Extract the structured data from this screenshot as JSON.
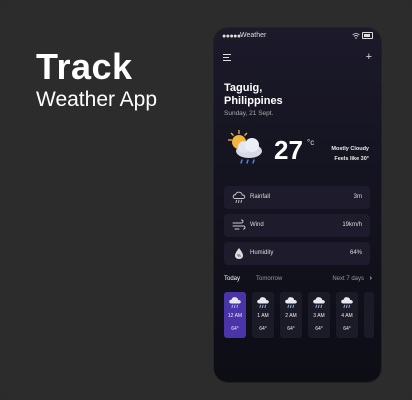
{
  "hero": {
    "title": "Track",
    "subtitle": "Weather App"
  },
  "status_bar": {
    "carrier": "Weather",
    "signal_dots": "●●●●●",
    "wifi": "wifi-icon",
    "battery": "battery-icon"
  },
  "header": {
    "menu_icon": "menu-icon",
    "add_icon": "plus-icon"
  },
  "location": {
    "city_line1": "Taguig,",
    "city_line2": "Philippines",
    "date": "Sunday, 21 Sept."
  },
  "current": {
    "temperature": "27",
    "unit": "°c",
    "condition": "Mostly Cloudy",
    "feels_like": "Feels like 30°",
    "icon": "partly-cloudy-rain-icon"
  },
  "metrics": [
    {
      "label": "Rainfall",
      "value": "3m",
      "icon": "rain-cloud-icon"
    },
    {
      "label": "Wind",
      "value": "19km/h",
      "icon": "wind-icon"
    },
    {
      "label": "Humidity",
      "value": "64%",
      "icon": "humidity-drop-icon"
    }
  ],
  "tabs": {
    "today": "Today",
    "tomorrow": "Tomorrow",
    "next": "Next 7 days",
    "chevron": "›"
  },
  "hourly": [
    {
      "time": "12 AM",
      "temp": "64°",
      "active": true
    },
    {
      "time": "1 AM",
      "temp": "64°",
      "active": false
    },
    {
      "time": "2 AM",
      "temp": "64°",
      "active": false
    },
    {
      "time": "3 AM",
      "temp": "64°",
      "active": false
    },
    {
      "time": "4 AM",
      "temp": "64°",
      "active": false
    }
  ],
  "colors": {
    "accent": "#4a34a8",
    "card": "#1e1c2c",
    "background": "#2c2c2c",
    "sun": "#f2b43a"
  }
}
